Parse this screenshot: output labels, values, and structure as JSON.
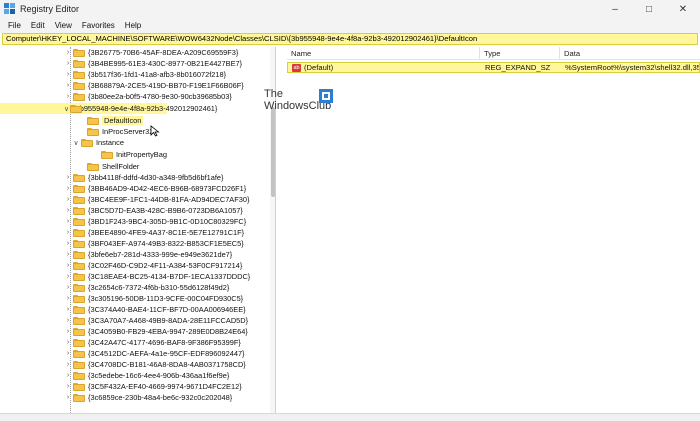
{
  "window": {
    "title": "Registry Editor"
  },
  "menu": [
    "File",
    "Edit",
    "View",
    "Favorites",
    "Help"
  ],
  "address": "Computer\\HKEY_LOCAL_MACHINE\\SOFTWARE\\WOW6432Node\\Classes\\CLSID\\{3b955948-9e4e-4f8a-92b3-492012902461}\\DefaultIcon",
  "tree": {
    "above": [
      "{3B26775-70B6-45AF-8DEA-A209C69559F3}",
      "{3B4BE995-61E3-430C-8977-0B21E4427BE7}",
      "{3b517f36-1fd1-41a8-afb3-8b016072f218}",
      "{3B68879A-2CE5-419D-BB70-F19E1F66B06F}",
      "{3b80ee2a-b0f5-4780-9e30-90cb39685b03}"
    ],
    "expanded": "{3b955948-9e4e-4f8a-92b3-492012902461}",
    "children": {
      "default_icon": "DefaultIcon",
      "inproc": "InProcServer32",
      "instance": "Instance",
      "init_bag": "InitPropertyBag",
      "shell_folder": "ShellFolder"
    },
    "below": [
      "{3bb4118f-ddfd-4d30-a348-9fb5d6bf1afe}",
      "{3BB46AD9-4D42-4EC6-B96B-68973FCD26F1}",
      "{3BC4EE9F-1FC1-44DB-81FA-AD94DEC7AF30}",
      "{3BC5D7D-EA3B-428C-B9B6-0723DB6A1057}",
      "{3BD1F243-9BC4-305D-9B1C-0D10C80329FC}",
      "{3BEE4890-4FE9-4A37-8C1E-5E7E12791C1F}",
      "{3BF043EF-A974-49B3-8322-B853CF1E5EC5}",
      "{3bfe6eb7-281d-4333-999e-e949e3621de7}",
      "{3C02F46D-C9D2-4F11-A384-53F0CF917214}",
      "{3C18EAE4-BC25-4134-B7DF-1ECA1337DDDC}",
      "{3c2654c6-7372-4f6b-b310-55d6128f49d2}",
      "{3c305196-50DB-11D3-9CFE-00C04FD930C5}",
      "{3C374A40-BAE4-11CF-BF7D-00AA006946EE}",
      "{3C3A70A7-A468-49B9-8ADA-28E11FCCAD5D}",
      "{3C4059B0-FB29-4EBA-9947-289E0D8B24E64}",
      "{3C42A47C-4177-4696-BAF8-9F386F95399F}",
      "{3C4512DC-AEFA-4a1e-95CF-EDF896092447}",
      "{3C4708DC-B181-46A8-8DA8-4AB0371758CD}",
      "{3c5edebe-16c6-4ee4-906b-436aa1f6ef9e}",
      "{3C5F432A-EF40-4669-9974-9671D4FC2E12}",
      "{3c6859ce-230b-48a4-be6c-932c0c202048}"
    ]
  },
  "list": {
    "headers": {
      "name": "Name",
      "type": "Type",
      "data": "Data"
    },
    "rows": [
      {
        "icon": "ab",
        "name": "(Default)",
        "type": "REG_EXPAND_SZ",
        "data": "%SystemRoot%\\system32\\shell32.dll,35"
      }
    ]
  },
  "watermark": {
    "line1": "The",
    "line2": "WindowsClub"
  },
  "colors": {
    "highlight": "#fff79a",
    "folder": "#f6c34b",
    "accent": "#2a7fd4"
  },
  "icons": [
    "regedit-icon",
    "folder-icon",
    "string-value-icon",
    "minimize-icon",
    "maximize-icon",
    "close-icon"
  ]
}
